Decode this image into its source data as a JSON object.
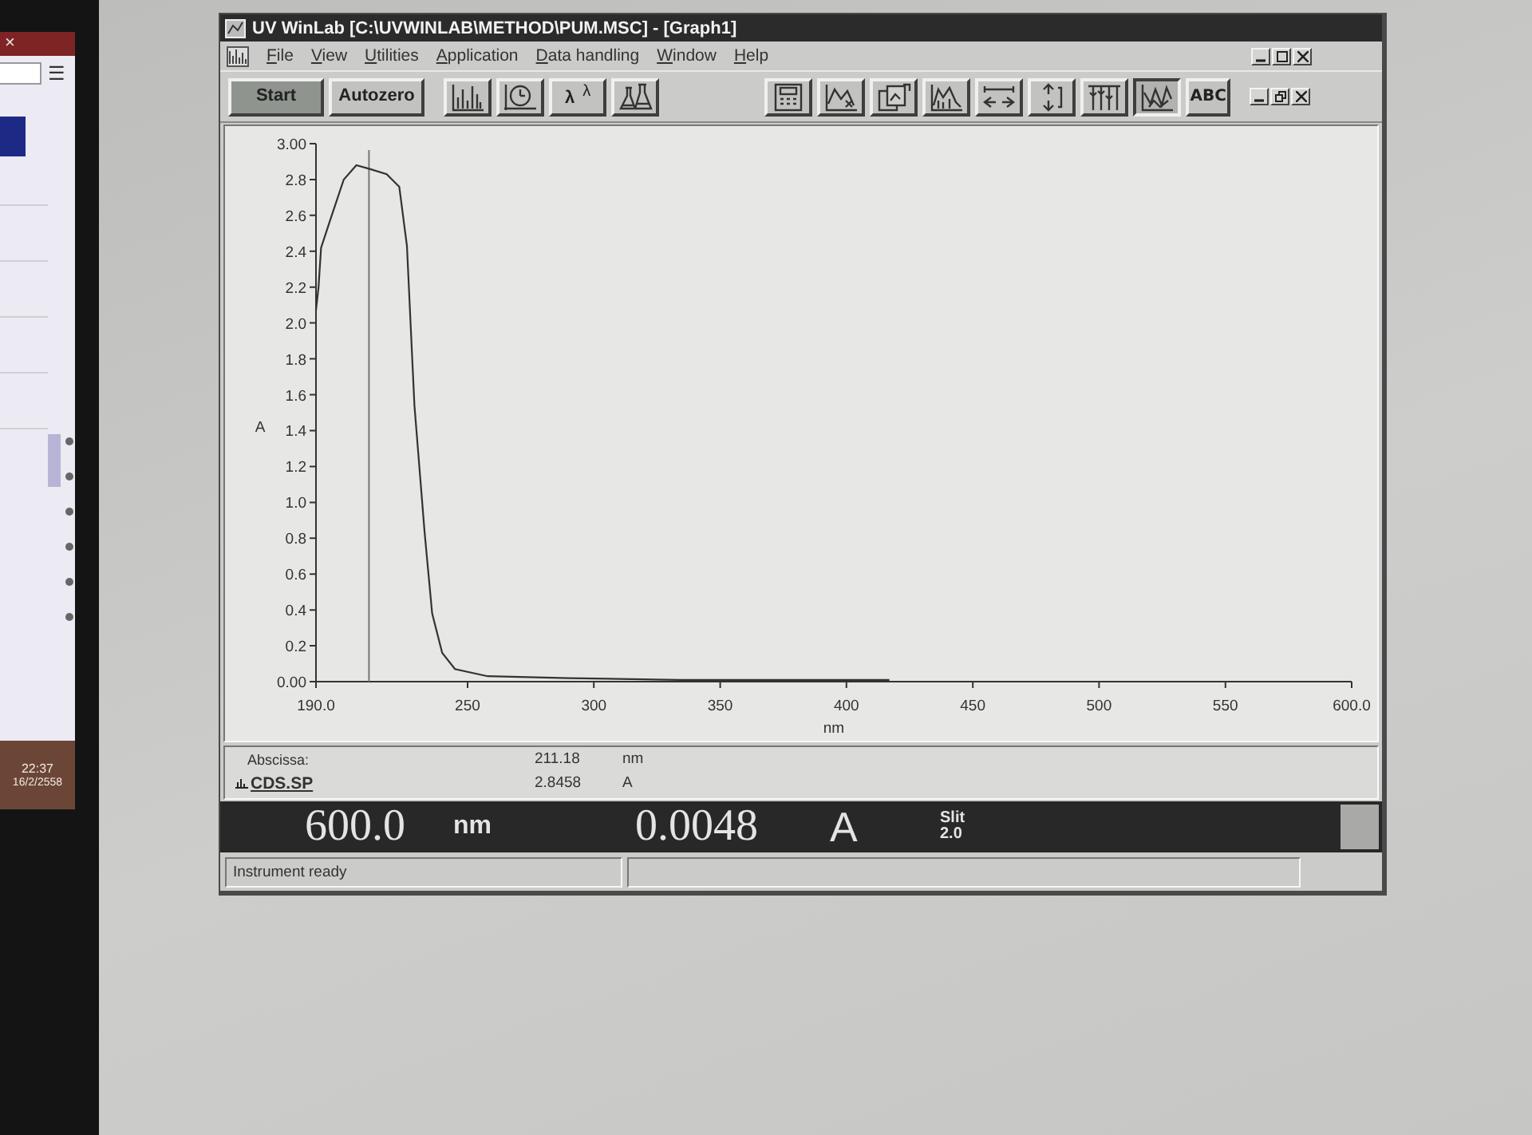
{
  "laptop_screen": {
    "close": "×",
    "menu": "☰",
    "time": "22:37",
    "date": "16/2/2558"
  },
  "window": {
    "title": "UV WinLab [C:\\UVWINLAB\\METHOD\\PUM.MSC] - [Graph1]"
  },
  "menu": [
    "File",
    "View",
    "Utilities",
    "Application",
    "Data handling",
    "Window",
    "Help"
  ],
  "toolbar": {
    "left": [
      {
        "kind": "text",
        "label": "Start",
        "highlighted": true,
        "pressed": false
      },
      {
        "kind": "text",
        "label": "Autozero",
        "highlighted": false,
        "pressed": false
      },
      {
        "kind": "icon",
        "highlighted": false,
        "pressed": false
      },
      {
        "kind": "icon",
        "highlighted": false,
        "pressed": false
      },
      {
        "kind": "text",
        "label": "λ$^{λ}$",
        "highlighted": false,
        "pressed": false
      },
      {
        "kind": "icon",
        "highlighted": false,
        "pressed": false
      }
    ],
    "right": [
      {
        "kind": "icon",
        "highlighted": false,
        "pressed": false
      },
      {
        "kind": "icon",
        "highlighted": false,
        "pressed": false
      },
      {
        "kind": "icon",
        "highlighted": false,
        "pressed": false
      },
      {
        "kind": "icon",
        "highlighted": false,
        "pressed": false
      },
      {
        "kind": "icon",
        "highlighted": false,
        "pressed": false
      },
      {
        "kind": "icon",
        "highlighted": false,
        "pressed": false
      },
      {
        "kind": "icon",
        "highlighted": false,
        "pressed": false
      },
      {
        "kind": "icon",
        "highlighted": false,
        "pressed": true
      },
      {
        "kind": "text",
        "label": "ABC",
        "highlighted": false,
        "pressed": false
      }
    ]
  },
  "graph": {
    "chart_data": {
      "type": "line",
      "xlabel": "nm",
      "ylabel": "A",
      "x": [
        190,
        191,
        192,
        196,
        201,
        206,
        211,
        218,
        223,
        226,
        229,
        233,
        236,
        240,
        245,
        258,
        290,
        334,
        417
      ],
      "series": [
        {
          "values": [
            2.07,
            2.2,
            2.42,
            2.59,
            2.8,
            2.88,
            2.86,
            2.83,
            2.76,
            2.43,
            1.54,
            0.83,
            0.38,
            0.16,
            0.07,
            0.03,
            0.02,
            0.01,
            0.01
          ]
        }
      ],
      "xlim": [
        190,
        600
      ],
      "ylim": [
        0,
        3
      ],
      "xticks": [
        {
          "value": 190,
          "label": "190.0"
        },
        250,
        300,
        350,
        400,
        450,
        500,
        550,
        {
          "value": 600,
          "label": "600.0"
        }
      ],
      "yticks": [
        {
          "value": 0,
          "label": "0.00"
        },
        0.2,
        0.4,
        0.6,
        0.8,
        {
          "value": 1,
          "label": "1.0"
        },
        1.2,
        1.4,
        1.6,
        1.8,
        {
          "value": 2,
          "label": "2.0"
        },
        2.2,
        2.4,
        2.6,
        2.8,
        {
          "value": 3,
          "label": "3.00"
        }
      ],
      "ref_lines": [
        {
          "axis": "x",
          "value": 211
        }
      ]
    }
  },
  "cursor_readout": {
    "label": "Abscissa:",
    "sample": "CDS.SP",
    "x_value": "211.18",
    "x_unit": "nm",
    "y_value": "2.8458",
    "y_unit": "A"
  },
  "display": {
    "wavelength": "600.0",
    "wavelength_unit": "nm",
    "reading": "0.0048",
    "reading_unit": "A",
    "slit_label": "Slit",
    "slit_value": "2.0"
  },
  "status_bar": {
    "message": "Instrument ready"
  }
}
